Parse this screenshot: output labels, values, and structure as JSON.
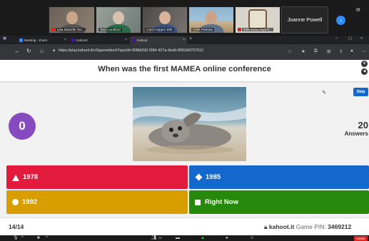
{
  "zoom": {
    "participants": [
      {
        "name": "Lisa Danielle Tos..."
      },
      {
        "name": "Tami Lunsford"
      },
      {
        "name": "Carol Hopper Brill"
      },
      {
        "name": "Chris Petrone"
      },
      {
        "name": "Glen Echo Park A..."
      }
    ],
    "name_tile": "Joanne Powell",
    "leave_label": "Leave",
    "participant_count": "26"
  },
  "browser": {
    "tabs": [
      {
        "label": "Meeting - Zoom"
      },
      {
        "label": "Kahoot!"
      },
      {
        "label": "Kahoot"
      }
    ],
    "url": "https://play.kahoot.it/v2/gameblock?quizId=308bf2d2-f284-427a-9edd-8052d0707012"
  },
  "kahoot": {
    "question": "When was the first MAMEA online conference",
    "timer": "0",
    "skip_label": "Skip",
    "answers_count": "20",
    "answers_label": "Answers",
    "answers": [
      {
        "label": "1978",
        "color": "#e21b3c",
        "shape": "triangle"
      },
      {
        "label": "1985",
        "color": "#1368ce",
        "shape": "diamond"
      },
      {
        "label": "1992",
        "color": "#d89e00",
        "shape": "circle"
      },
      {
        "label": "Right Now",
        "color": "#26890c",
        "shape": "square"
      }
    ],
    "progress": "14/14",
    "site": "kahoot.it",
    "pin_label": "Game PIN:",
    "pin": "3469212"
  }
}
